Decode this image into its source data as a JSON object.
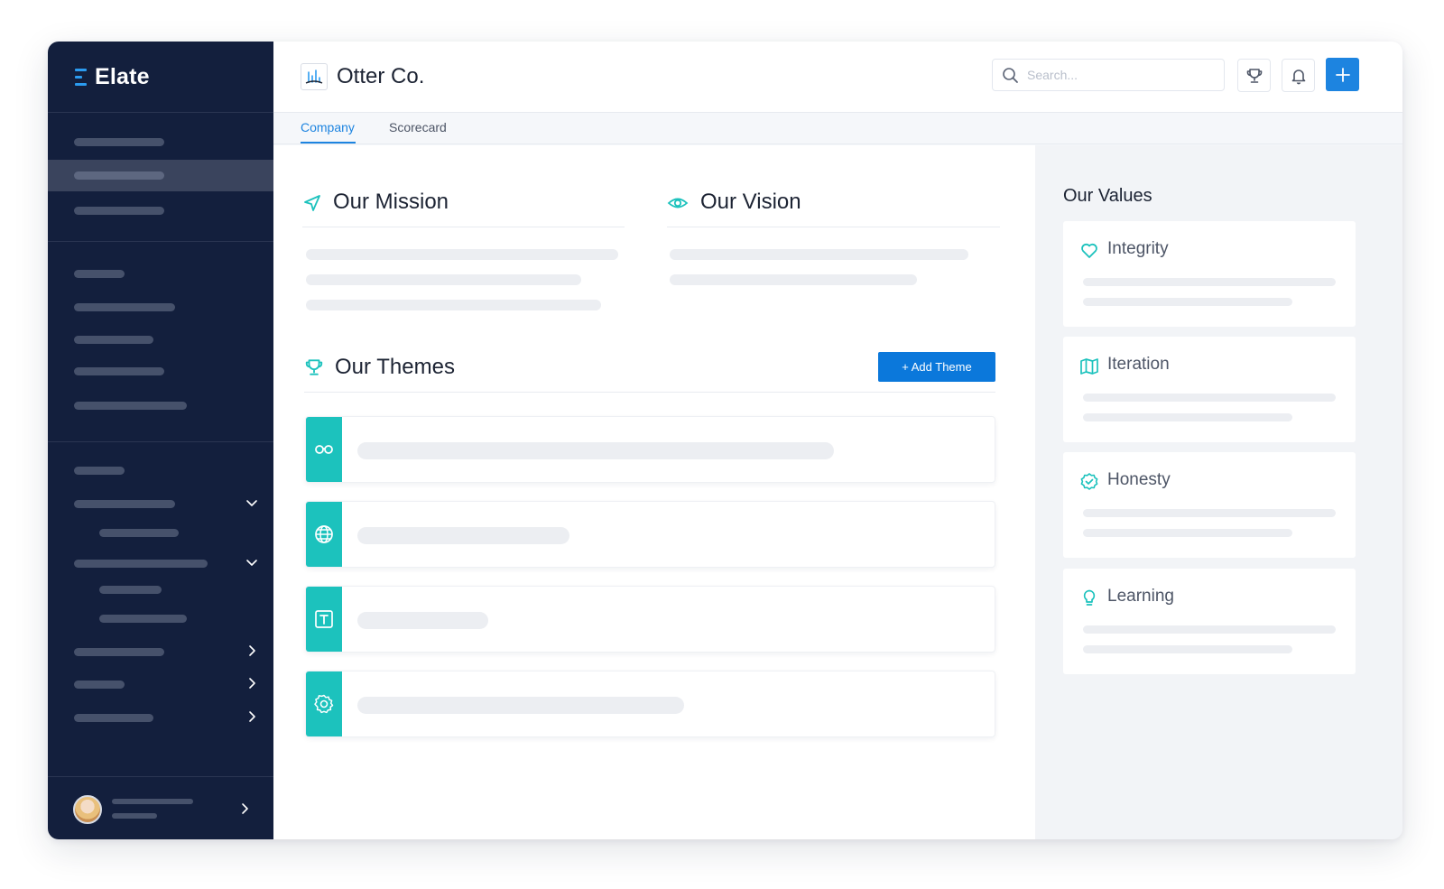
{
  "brand": {
    "name": "Elate"
  },
  "header": {
    "company": "Otter Co.",
    "search_placeholder": "Search..."
  },
  "tabs": [
    {
      "label": "Company",
      "active": true
    },
    {
      "label": "Scorecard",
      "active": false
    }
  ],
  "mission": {
    "title": "Our Mission",
    "icon": "send-icon"
  },
  "vision": {
    "title": "Our Vision",
    "icon": "eye-icon"
  },
  "themes": {
    "title": "Our Themes",
    "icon": "trophy-icon",
    "add_label": "+ Add Theme",
    "items": [
      {
        "icon": "glasses-icon"
      },
      {
        "icon": "globe-icon"
      },
      {
        "icon": "text-box-icon"
      },
      {
        "icon": "gear-icon"
      }
    ]
  },
  "values": {
    "title": "Our Values",
    "items": [
      {
        "name": "Integrity",
        "icon": "heart-icon"
      },
      {
        "name": "Iteration",
        "icon": "map-icon"
      },
      {
        "name": "Honesty",
        "icon": "check-badge-icon"
      },
      {
        "name": "Learning",
        "icon": "lightbulb-icon"
      }
    ]
  },
  "colors": {
    "sidebar": "#131f3d",
    "accent_blue": "#1d84e0",
    "teal": "#1cc2bd"
  }
}
